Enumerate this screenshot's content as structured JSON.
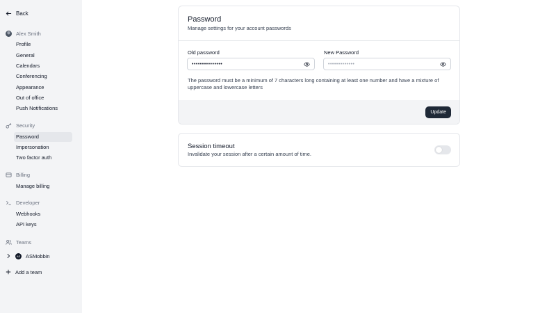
{
  "sidebar": {
    "back_label": "Back",
    "user": {
      "name": "Alex Smith",
      "items": [
        {
          "label": "Profile"
        },
        {
          "label": "General"
        },
        {
          "label": "Calendars"
        },
        {
          "label": "Conferencing"
        },
        {
          "label": "Appearance"
        },
        {
          "label": "Out of office"
        },
        {
          "label": "Push Notifications"
        }
      ]
    },
    "security": {
      "label": "Security",
      "icon": "key-icon",
      "items": [
        {
          "label": "Password",
          "active": true
        },
        {
          "label": "Impersonation"
        },
        {
          "label": "Two factor auth"
        }
      ]
    },
    "billing": {
      "label": "Billing",
      "icon": "credit-card-icon",
      "items": [
        {
          "label": "Manage billing"
        }
      ]
    },
    "developer": {
      "label": "Developer",
      "icon": "terminal-icon",
      "items": [
        {
          "label": "Webhooks"
        },
        {
          "label": "API keys"
        }
      ]
    },
    "teams": {
      "label": "Teams",
      "icon": "users-icon",
      "team": {
        "name": "ASMobbin",
        "logo_text": "AS"
      },
      "add_label": "Add a team"
    }
  },
  "password_card": {
    "title": "Password",
    "subtitle": "Manage settings for your account passwords",
    "old_password": {
      "label": "Old password",
      "value": "•••••••••••••••"
    },
    "new_password": {
      "label": "New Password",
      "placeholder": "•••••••••••••"
    },
    "note": "The password must be a minimum of 7 characters long containing at least one number and have a mixture of uppercase and lowercase letters",
    "update_label": "Update"
  },
  "session_card": {
    "title": "Session timeout",
    "subtitle": "Invalidate your session after a certain amount of time.",
    "toggle_on": false
  },
  "colors": {
    "sidebar_bg": "#f3f4f6",
    "active_item_bg": "#e5e7eb",
    "primary_button": "#1f2937"
  }
}
